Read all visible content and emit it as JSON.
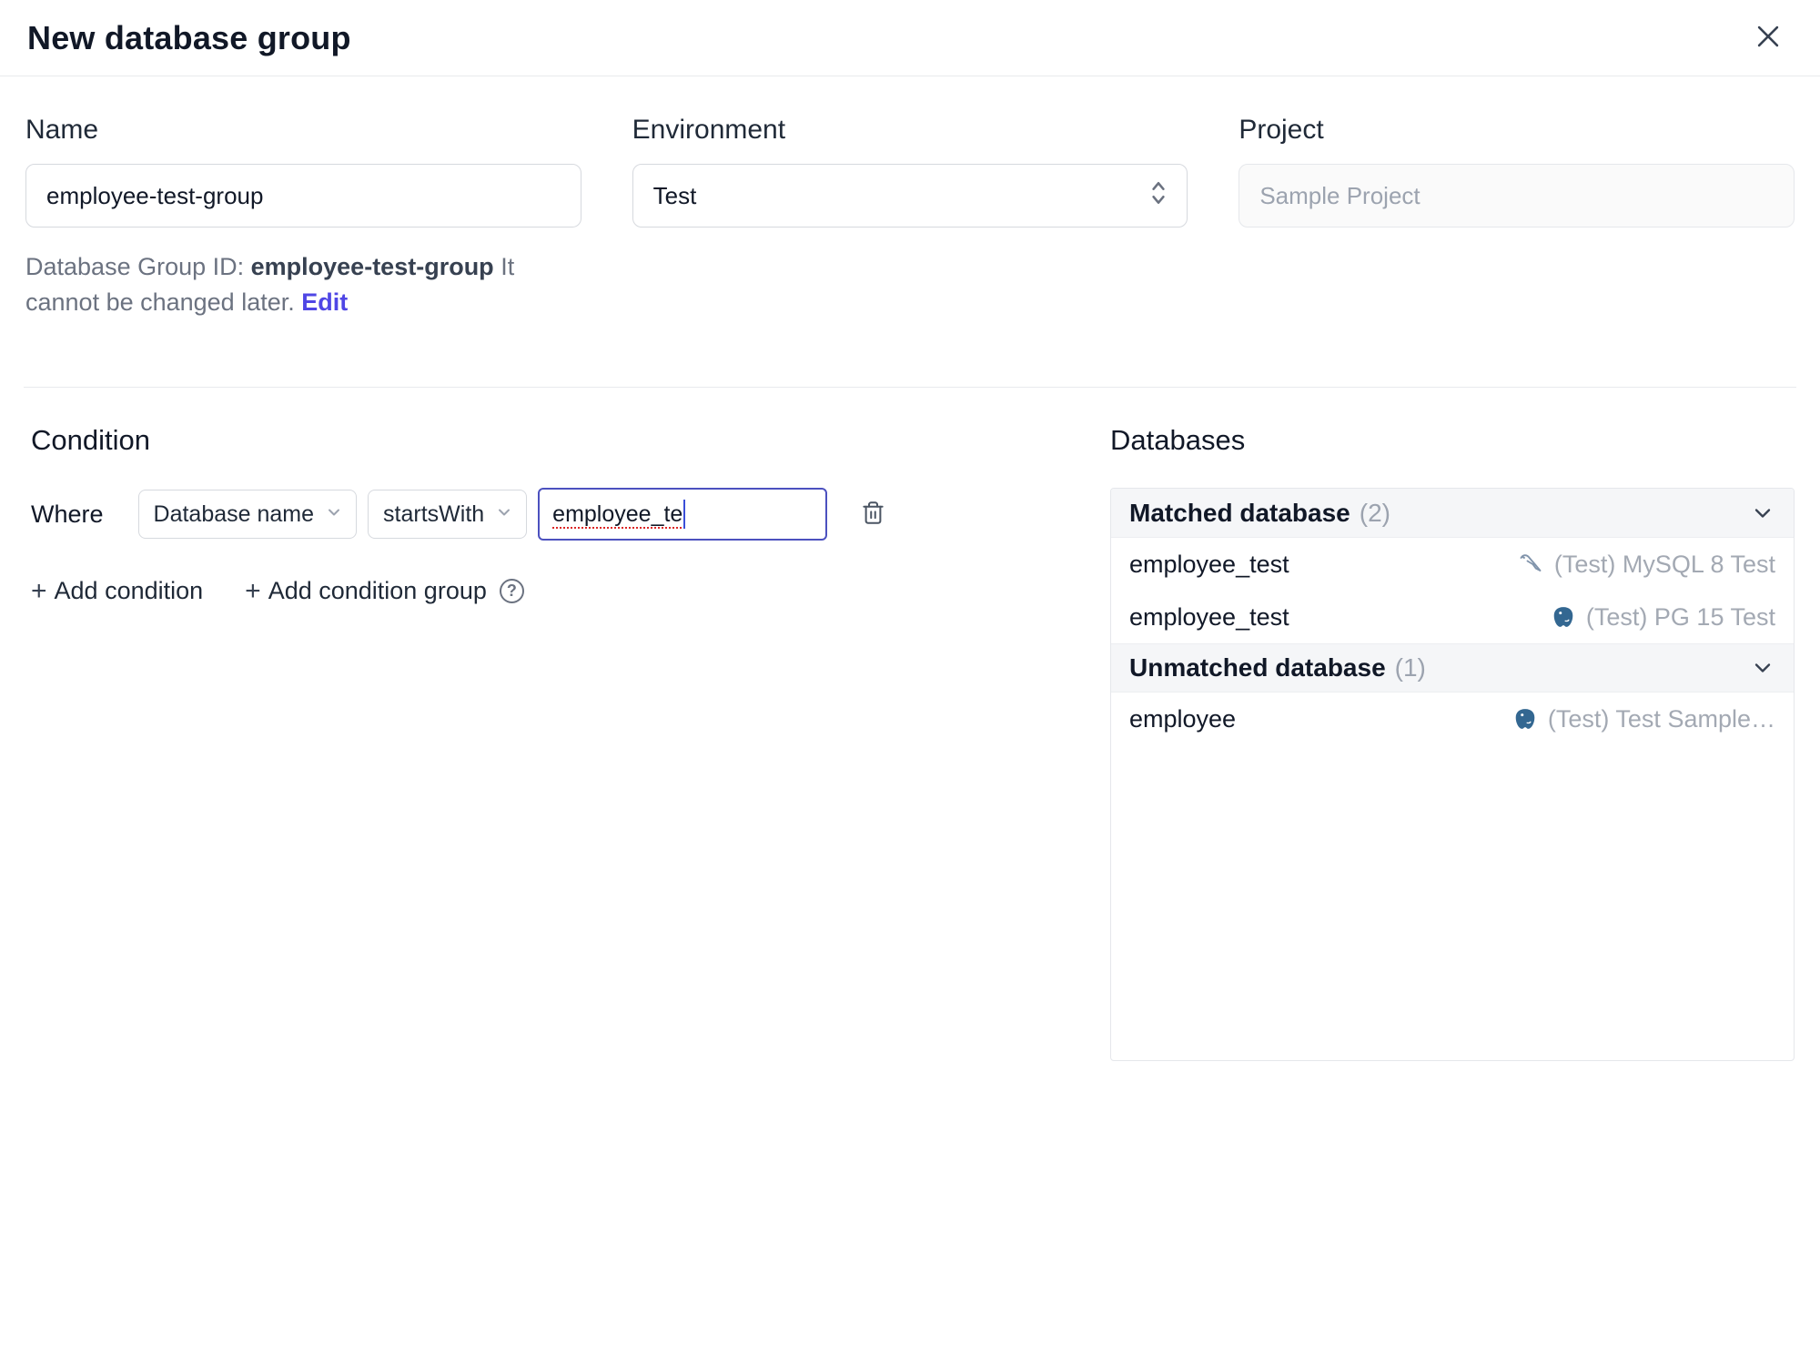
{
  "dialog": {
    "title": "New database group"
  },
  "form": {
    "name": {
      "label": "Name",
      "value": "employee-test-group"
    },
    "environment": {
      "label": "Environment",
      "value": "Test"
    },
    "project": {
      "label": "Project",
      "value": "Sample Project"
    },
    "group_id": {
      "prefix": "Database Group ID: ",
      "id": "employee-test-group",
      "suffix": " It cannot be changed later. ",
      "edit_label": "Edit"
    }
  },
  "condition": {
    "heading": "Condition",
    "where_label": "Where",
    "field_select": "Database name",
    "operator_select": "startsWith",
    "value_input": "employee_te",
    "add_condition_label": "Add condition",
    "add_condition_group_label": "Add condition group",
    "plus": "+",
    "help_glyph": "?"
  },
  "databases": {
    "heading": "Databases",
    "sections": [
      {
        "title": "Matched database",
        "count": "(2)",
        "rows": [
          {
            "name": "employee_test",
            "engine": "mysql",
            "instance": "(Test) MySQL 8 Test"
          },
          {
            "name": "employee_test",
            "engine": "postgres",
            "instance": "(Test) PG 15 Test"
          }
        ]
      },
      {
        "title": "Unmatched database",
        "count": "(1)",
        "rows": [
          {
            "name": "employee",
            "engine": "postgres",
            "instance": "(Test) Test Sample…"
          }
        ]
      }
    ]
  },
  "colors": {
    "accent": "#4f46e5",
    "focus_border": "#4c51bf",
    "muted_text": "#9ca3af"
  }
}
